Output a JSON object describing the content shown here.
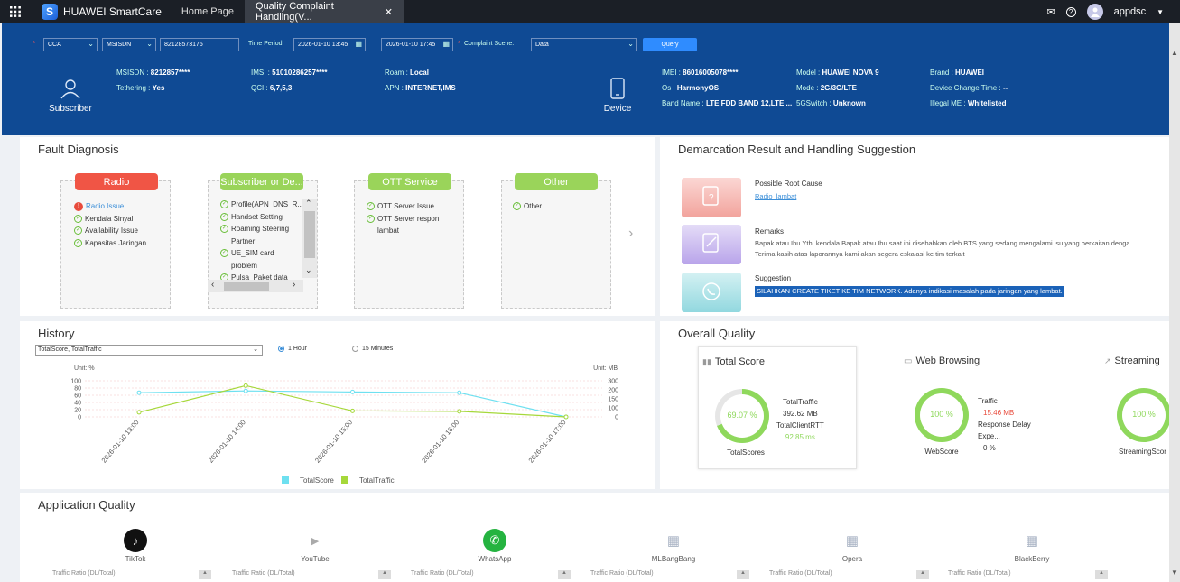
{
  "topbar": {
    "brand": "HUAWEI SmartCare",
    "tabs": [
      {
        "label": "Home Page"
      },
      {
        "label": "Quality Complaint Handling(V..."
      }
    ],
    "user": "appdsc"
  },
  "filters": {
    "area": "CCA",
    "id_type": "MSISDN",
    "msisdn": "82128573175",
    "time_period_label": "Time Period:",
    "time_from": "2026-01-10 13:45",
    "time_to": "2026-01-10 17:45",
    "scene_label": "Complaint Scene:",
    "scene": "Data",
    "query_label": "Query"
  },
  "subscriber": {
    "label": "Subscriber",
    "msisdn_k": "MSISDN :",
    "msisdn_v": "8212857****",
    "tethering_k": "Tethering :",
    "tethering_v": "Yes",
    "imsi_k": "IMSI :",
    "imsi_v": "51010286257****",
    "qci_k": "QCI :",
    "qci_v": "6,7,5,3",
    "roam_k": "Roam :",
    "roam_v": "Local",
    "apn_k": "APN :",
    "apn_v": "INTERNET,IMS"
  },
  "device": {
    "label": "Device",
    "imei_k": "IMEI :",
    "imei_v": "86016005078****",
    "os_k": "Os :",
    "os_v": "HarmonyOS",
    "band_k": "Band Name :",
    "band_v": "LTE FDD BAND 12,LTE ...",
    "model_k": "Model :",
    "model_v": "HUAWEI NOVA 9",
    "mode_k": "Mode :",
    "mode_v": "2G/3G/LTE",
    "g5_k": "5GSwitch :",
    "g5_v": "Unknown",
    "brand_k": "Brand :",
    "brand_v": "HUAWEI",
    "dct_k": "Device Change Time :",
    "dct_v": "--",
    "illegal_k": "Illegal ME :",
    "illegal_v": "Whitelisted"
  },
  "fault": {
    "title": "Fault Diagnosis",
    "radio": {
      "head": "Radio",
      "items": [
        "Radio Issue",
        "Kendala Sinyal",
        "Availability Issue",
        "Kapasitas Jaringan"
      ]
    },
    "subscriber": {
      "head": "Subscriber or De...",
      "items": [
        "Profile(APN_DNS_R...",
        "Handset Setting",
        "Roaming Steering",
        "Partner",
        "UE_SIM card",
        "problem",
        "Pulsa_Paket data"
      ]
    },
    "ott": {
      "head": "OTT Service",
      "items": [
        "OTT Server Issue",
        "OTT Server respon",
        "lambat"
      ]
    },
    "other": {
      "head": "Other",
      "items": [
        "Other"
      ]
    }
  },
  "demarcation": {
    "title": "Demarcation Result and Handling Suggestion",
    "root_title": "Possible Root Cause",
    "root_value": "Radio_lambat",
    "remarks_title": "Remarks",
    "remarks_line1": "Bapak atau Ibu Yth, kendala Bapak atau Ibu saat ini disebabkan oleh BTS yang sedang mengalami isu yang berkaitan denga",
    "remarks_line2": "Terima kasih atas laporannya kami akan segera eskalasi ke tim terkait",
    "suggestion_title": "Suggestion",
    "suggestion_value": "SILAHKAN CREATE TIKET KE TIM NETWORK. Adanya indikasi masalah pada jaringan yang lambat."
  },
  "history": {
    "title": "History",
    "select": "TotalScore, TotalTraffic",
    "opt_1h": "1 Hour",
    "opt_15m": "15 Minutes"
  },
  "chart_data": {
    "type": "line",
    "x": [
      "2026-01-10 13:00",
      "2026-01-10 14:00",
      "2026-01-10 15:00",
      "2026-01-10 16:00",
      "2026-01-10 17:00"
    ],
    "y_left_label": "Unit: %",
    "y_right_label": "Unit: MB",
    "y_left_ticks": [
      "100",
      "80",
      "60",
      "40",
      "20",
      "0"
    ],
    "y_right_ticks": [
      "300",
      "200",
      "150",
      "100",
      "0"
    ],
    "ylim_left": [
      0,
      100
    ],
    "ylim_right": [
      0,
      300
    ],
    "series": [
      {
        "name": "TotalScore",
        "axis": "left",
        "color": "#6ee0f0",
        "values": [
          67,
          72,
          69,
          67,
          0
        ]
      },
      {
        "name": "TotalTraffic",
        "axis": "right",
        "color": "#a6d83a",
        "values": [
          38,
          260,
          50,
          46,
          0
        ]
      }
    ],
    "legend_position": "bottom"
  },
  "overall": {
    "title": "Overall Quality",
    "total": {
      "head": "Total Score",
      "pct": "69.07 %",
      "pct_value": 69.07,
      "caption": "TotalScores",
      "k1": "TotalTraffic",
      "v1": "392.62 MB",
      "k2": "TotalClientRTT",
      "v2": "92.85 ms"
    },
    "web": {
      "head": "Web Browsing",
      "pct": "100 %",
      "pct_value": 100,
      "caption": "WebScore",
      "k1": "Traffic",
      "v1": "15.46 MB",
      "k2": "Response Delay Expe...",
      "v2": "0 %"
    },
    "stream": {
      "head": "Streaming",
      "pct": "100 %",
      "pct_value": 100,
      "caption": "StreamingScor"
    }
  },
  "appq": {
    "title": "Application Quality",
    "apps": [
      {
        "name": "TikTok",
        "ratio": "Traffic Ratio (DL/Total)"
      },
      {
        "name": "YouTube",
        "ratio": "Traffic Ratio (DL/Total)"
      },
      {
        "name": "WhatsApp",
        "ratio": "Traffic Ratio (DL/Total)"
      },
      {
        "name": "MLBangBang",
        "ratio": "Traffic Ratio (DL/Total)"
      },
      {
        "name": "Opera",
        "ratio": "Traffic Ratio (DL/Total)"
      },
      {
        "name": "BlackBerry",
        "ratio": "Traffic Ratio (DL/Total)"
      }
    ]
  },
  "colors": {
    "banner": "#0f4a94",
    "radio": "#f05545",
    "ok": "#9ad45a",
    "ring": "#8fd85c"
  }
}
